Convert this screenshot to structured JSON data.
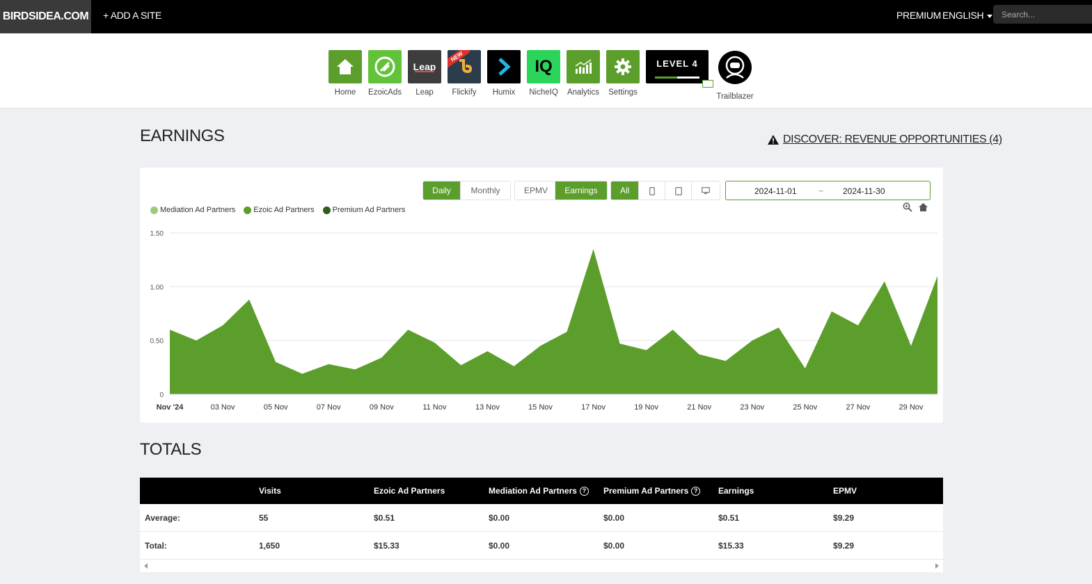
{
  "topbar": {
    "brand": "BIRDSIDEA.COM",
    "add_site": "+ ADD A SITE",
    "premium": "PREMIUM",
    "language": "ENGLISH",
    "search_placeholder": "Search..."
  },
  "apps": [
    {
      "label": "Home",
      "icon": "house-icon",
      "color": "#5c9e2b"
    },
    {
      "label": "EzoicAds",
      "icon": "ezoicads-icon",
      "color": "#62c33a"
    },
    {
      "label": "Leap",
      "icon": "leap-icon",
      "color": "#3d3d3d",
      "logo_text": "Leap"
    },
    {
      "label": "Flickify",
      "icon": "flickify-icon",
      "color": "#2b3d4d",
      "badge": "NEW"
    },
    {
      "label": "Humix",
      "icon": "humix-icon",
      "color": "#000000"
    },
    {
      "label": "NicheIQ",
      "icon": "nicheiq-icon",
      "color": "#2bd45a",
      "logo_text": "IQ"
    },
    {
      "label": "Analytics",
      "icon": "analytics-icon",
      "color": "#5c9e2b"
    },
    {
      "label": "Settings",
      "icon": "gear-icon",
      "color": "#5c9e2b"
    }
  ],
  "level_badge": {
    "text": "LEVEL 4",
    "progress": 0.5
  },
  "trailblazer": {
    "label": "Trailblazer"
  },
  "earnings": {
    "title": "EARNINGS",
    "discover_link": "DISCOVER: REVENUE OPPORTUNITIES (4)"
  },
  "controls": {
    "period": [
      {
        "label": "Daily",
        "active": true
      },
      {
        "label": "Monthly",
        "active": false
      }
    ],
    "metric": [
      {
        "label": "EPMV",
        "active": false
      },
      {
        "label": "Earnings",
        "active": true
      }
    ],
    "device_all": "All",
    "date_start": "2024-11-01",
    "date_sep": "~",
    "date_end": "2024-11-30"
  },
  "colors": {
    "accent": "#5c9e2b",
    "mediation": "#9ccc7a",
    "ezoic": "#5c9e2b",
    "premium": "#2e5e17"
  },
  "chart_data": {
    "type": "area",
    "x": [
      "2024-11-01",
      "2024-11-02",
      "2024-11-03",
      "2024-11-04",
      "2024-11-05",
      "2024-11-06",
      "2024-11-07",
      "2024-11-08",
      "2024-11-09",
      "2024-11-10",
      "2024-11-11",
      "2024-11-12",
      "2024-11-13",
      "2024-11-14",
      "2024-11-15",
      "2024-11-16",
      "2024-11-17",
      "2024-11-18",
      "2024-11-19",
      "2024-11-20",
      "2024-11-21",
      "2024-11-22",
      "2024-11-23",
      "2024-11-24",
      "2024-11-25",
      "2024-11-26",
      "2024-11-27",
      "2024-11-28",
      "2024-11-29",
      "2024-11-30"
    ],
    "x_tick_labels": [
      "Nov '24",
      "03 Nov",
      "05 Nov",
      "07 Nov",
      "09 Nov",
      "11 Nov",
      "13 Nov",
      "15 Nov",
      "17 Nov",
      "19 Nov",
      "21 Nov",
      "23 Nov",
      "25 Nov",
      "27 Nov",
      "29 Nov"
    ],
    "y_ticks": [
      "0",
      "0.50",
      "1.00",
      "1.50"
    ],
    "ylim": [
      0,
      1.5
    ],
    "legend": [
      "Mediation Ad Partners",
      "Ezoic Ad Partners",
      "Premium Ad Partners"
    ],
    "legend_position": "top-left",
    "grid": true,
    "series": [
      {
        "name": "Mediation Ad Partners",
        "values": [
          0,
          0,
          0,
          0,
          0,
          0,
          0,
          0,
          0,
          0,
          0,
          0,
          0,
          0,
          0,
          0,
          0,
          0,
          0,
          0,
          0,
          0,
          0,
          0,
          0,
          0,
          0,
          0,
          0,
          0
        ]
      },
      {
        "name": "Ezoic Ad Partners",
        "values": [
          0.6,
          0.5,
          0.64,
          0.88,
          0.3,
          0.19,
          0.28,
          0.23,
          0.34,
          0.6,
          0.48,
          0.27,
          0.4,
          0.26,
          0.45,
          0.58,
          1.35,
          0.47,
          0.41,
          0.6,
          0.37,
          0.31,
          0.5,
          0.62,
          0.24,
          0.77,
          0.64,
          1.05,
          0.45,
          1.1
        ]
      },
      {
        "name": "Premium Ad Partners",
        "values": [
          0,
          0,
          0,
          0,
          0,
          0,
          0,
          0,
          0,
          0,
          0,
          0,
          0,
          0,
          0,
          0,
          0,
          0,
          0,
          0,
          0,
          0,
          0,
          0,
          0,
          0,
          0,
          0,
          0,
          0
        ]
      }
    ]
  },
  "totals": {
    "title": "TOTALS",
    "headers": [
      "Visits",
      "Ezoic Ad Partners",
      "Mediation Ad Partners",
      "Premium Ad Partners",
      "Earnings",
      "EPMV"
    ],
    "rows": [
      {
        "label": "Average:",
        "cells": [
          "55",
          "$0.51",
          "$0.00",
          "$0.00",
          "$0.51",
          "$9.29"
        ]
      },
      {
        "label": "Total:",
        "cells": [
          "1,650",
          "$15.33",
          "$0.00",
          "$0.00",
          "$15.33",
          "$9.29"
        ]
      }
    ]
  }
}
